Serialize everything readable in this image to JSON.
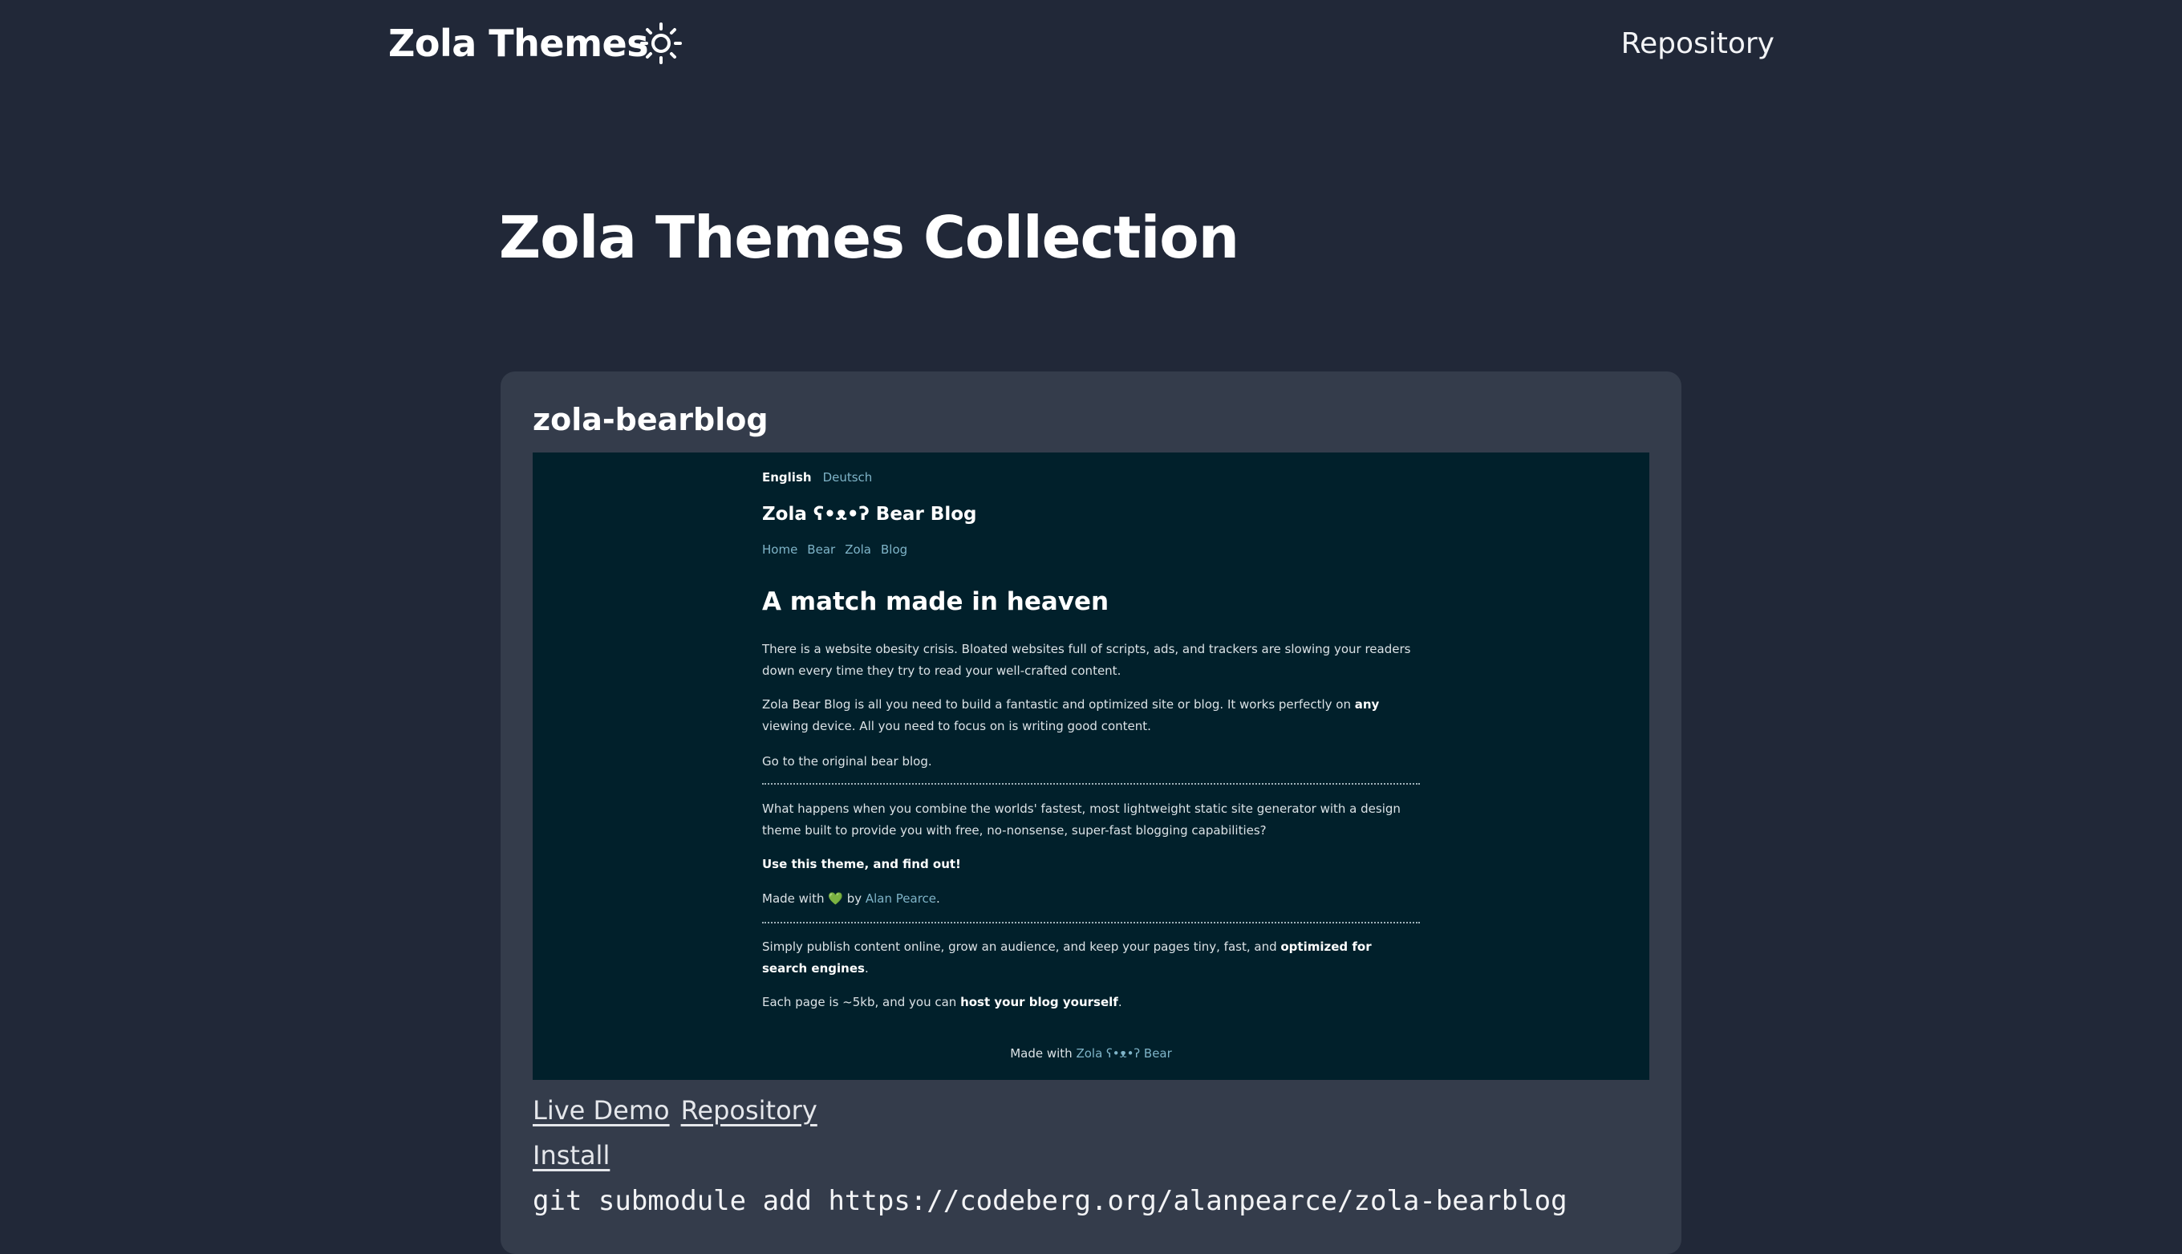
{
  "header": {
    "brand": "Zola Themes",
    "theme_toggle_icon": "sun-icon",
    "repository_label": "Repository"
  },
  "main": {
    "title": "Zola Themes Collection"
  },
  "theme_card": {
    "name": "zola-bearblog",
    "preview": {
      "lang_active": "English",
      "lang_other": "Deutsch",
      "site_title": "Zola ʕ•ᴥ•ʔ Bear Blog",
      "nav": [
        "Home",
        "Bear",
        "Zola",
        "Blog"
      ],
      "heading": "A match made in heaven",
      "p1": "There is a website obesity crisis. Bloated websites full of scripts, ads, and trackers are slowing your readers down every time they try to read your well-crafted content.",
      "p2_a": "Zola Bear Blog is all you need to build a fantastic and optimized site or blog. It works perfectly on ",
      "p2_b": "any",
      "p2_c": " viewing device. All you need to focus on is writing good content.",
      "p3_link": "Go to the original bear blog.",
      "p4": "What happens when you combine the worlds' fastest, most lightweight static site generator with a design theme built to provide you with free, no-nonsense, super-fast blogging capabilities?",
      "p5": "Use this theme, and find out!",
      "p6_a": "Made with ",
      "p6_heart": "💚",
      "p6_b": " by ",
      "p6_link": "Alan Pearce",
      "p6_c": ".",
      "p7_a": "Simply publish content online, grow an audience, and keep your pages tiny, fast, and ",
      "p7_b": "optimized for search engines",
      "p7_c": ".",
      "p8_a": "Each page is ~5kb, and you can ",
      "p8_b": "host your blog yourself",
      "p8_c": ".",
      "footer_a": "Made with ",
      "footer_link": "Zola ʕ•ᴥ•ʔ Bear"
    },
    "live_demo_label": "Live Demo",
    "repository_label": "Repository",
    "install_label": "Install",
    "install_command": "git submodule add https://codeberg.org/alanpearce/zola-bearblog"
  },
  "colors": {
    "page_bg": "#212838",
    "card_bg": "#343c4b",
    "preview_bg": "#01202b",
    "preview_link": "#7fb4c8"
  }
}
